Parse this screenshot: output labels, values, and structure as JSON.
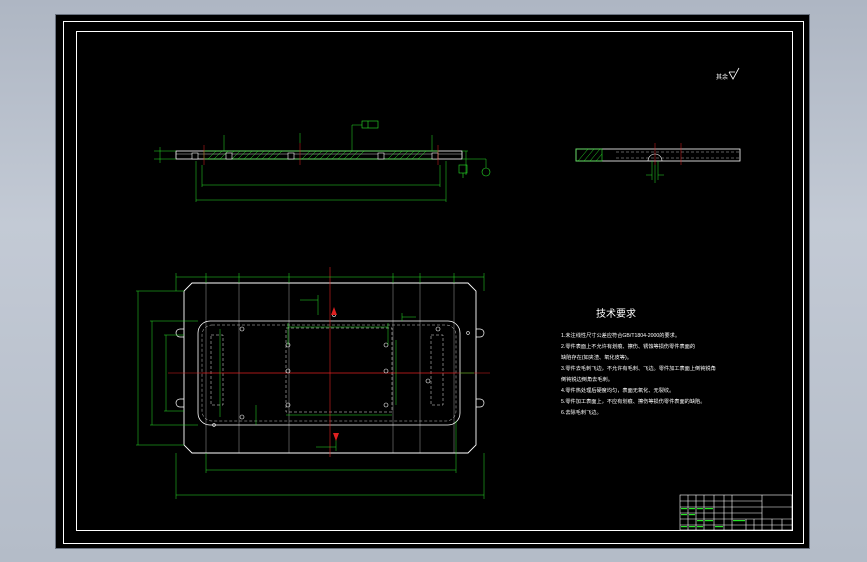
{
  "roughness_note": "其余",
  "tech_requirements": {
    "title": "技术要求",
    "items": [
      "1.未注线性尺寸公差应符合GB/T1804-2000的要求。",
      "2.零件表面上不允许有划痕、擦伤、锈蚀等损伤零件表面的",
      "缺陷存在(如夹渣、氧化皮等)。",
      "3.零件去毛刺飞边，不允许有毛刺、飞边。零件加工表面上倒钝锐角",
      "倒钝锐边倒角去毛刺。",
      "4.零件热处理后硬度均匀，表面无氧化、无裂纹。",
      "5.零件加工表面上，不应有划痕、擦伤等损伤零件表面的缺陷。",
      "6.去除毛刺飞边。"
    ]
  },
  "colors": {
    "background": "#000000",
    "outline": "#ffffff",
    "dimension": "#27e327",
    "centerline": "#e02020",
    "hidden": "#e8e8e8",
    "hatch": "#27e327"
  },
  "icons": {
    "roughness": "roughness-symbol-icon",
    "datum": "datum-circle-icon"
  }
}
